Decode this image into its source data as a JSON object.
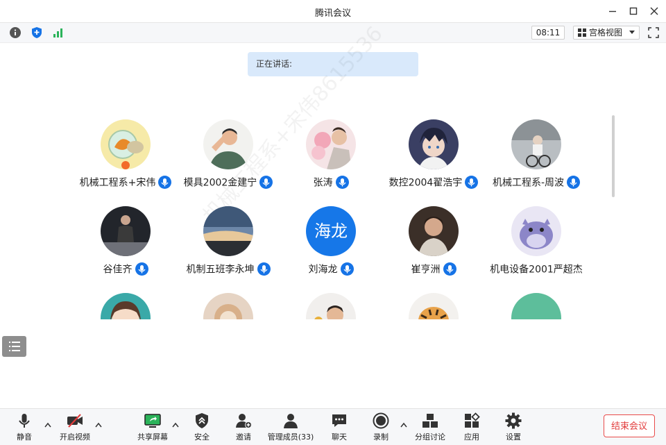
{
  "window": {
    "title": "腾讯会议"
  },
  "toolbar": {
    "time": "08:11",
    "view_label": "宫格视图"
  },
  "speaking": {
    "label": "正在讲话:"
  },
  "participants": [
    {
      "name": "机械工程系+宋伟",
      "avatar": "fishbowl-photo"
    },
    {
      "name": "模具2002金建宁",
      "avatar": "saluting-man-illustration"
    },
    {
      "name": "张涛",
      "avatar": "baby-flowers-photo"
    },
    {
      "name": "数控2004翟浩宇",
      "avatar": "anime-boy-illustration"
    },
    {
      "name": "机械工程系-周波",
      "avatar": "child-bicycle-photo"
    },
    {
      "name": "谷佳齐",
      "avatar": "woman-sitting-photo"
    },
    {
      "name": "机制五班李永坤",
      "avatar": "sunset-sky-photo"
    },
    {
      "name": "刘海龙",
      "avatar": "text-avatar",
      "avatar_text": "海龙"
    },
    {
      "name": "崔亨洲",
      "avatar": "boy-portrait-photo"
    },
    {
      "name": "机电设备2001严超杰",
      "avatar": "purple-cartoon-animal"
    },
    {
      "name": "",
      "avatar": "cartoon-girl"
    },
    {
      "name": "",
      "avatar": "plush-toy-photo"
    },
    {
      "name": "",
      "avatar": "child-photo"
    },
    {
      "name": "",
      "avatar": "tiger-cartoon"
    },
    {
      "name": "",
      "avatar": "green-circle"
    }
  ],
  "watermark": {
    "text": "机械工程系+宋伟8615536"
  },
  "bottom": {
    "mute": "静音",
    "video": "开启视频",
    "share": "共享屏幕",
    "security": "安全",
    "invite": "邀请",
    "members": "管理成员(33)",
    "chat": "聊天",
    "record": "录制",
    "breakout": "分组讨论",
    "apps": "应用",
    "settings": "设置",
    "end": "结束会议"
  },
  "colors": {
    "accent": "#1673e6",
    "end": "#e23b3b",
    "speaking_bg": "#d9e9fb",
    "share_green": "#2bb35a"
  }
}
